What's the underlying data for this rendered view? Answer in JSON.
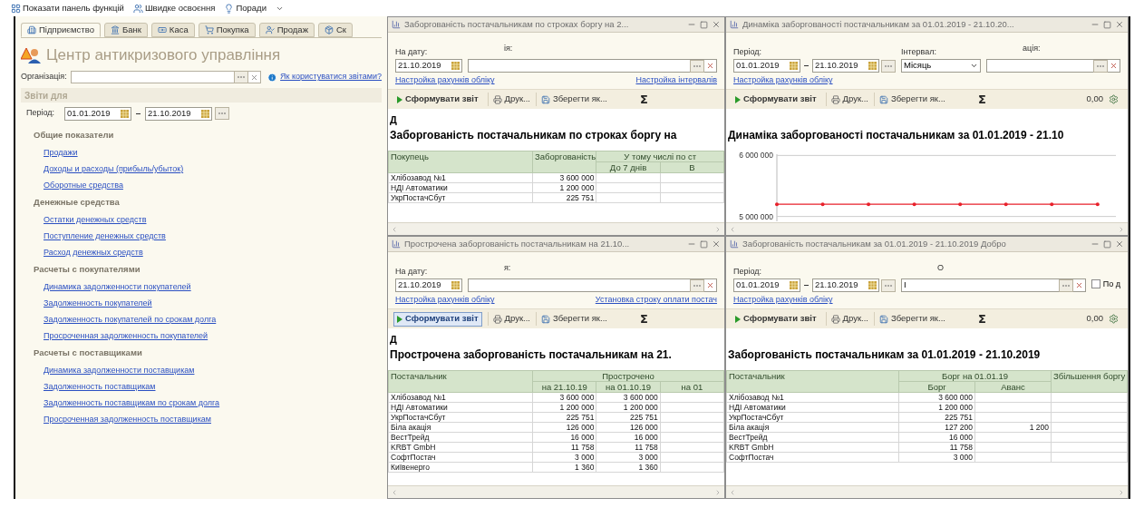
{
  "toolbar": [
    {
      "label": "Показати панель функцій"
    },
    {
      "label": "Швидке освоєння"
    },
    {
      "label": "Поради"
    }
  ],
  "main": {
    "tabs": [
      {
        "label": "Підприємство",
        "selected": true
      },
      {
        "label": "Банк",
        "selected": false
      },
      {
        "label": "Каса",
        "selected": false
      },
      {
        "label": "Покупка",
        "selected": false
      },
      {
        "label": "Продаж",
        "selected": false
      },
      {
        "label": "Ск",
        "selected": false
      }
    ],
    "title": "Центр антикризового управління",
    "organization": {
      "label": "Організація:"
    },
    "help_link": "Як користуватися звітами?",
    "section": "Звіти для",
    "period": {
      "label": "Період:",
      "from": "01.01.2019",
      "to": "21.10.2019"
    },
    "groups": [
      {
        "title": "Общие показатели",
        "links": [
          "Продажи",
          "Доходы и расходы (прибыль/убыток)",
          "Оборотные средства"
        ]
      },
      {
        "title": "Денежные средства",
        "links": [
          "Остатки денежных средств",
          "Поступление денежных средств",
          "Расход денежных средств"
        ]
      },
      {
        "title": "Расчеты с покупателями",
        "links": [
          "Динамика задолженности покупателей",
          "Задолженность покупателей",
          "Задолженность покупателей по срокам долга",
          "Просроченная задолженность покупателей"
        ]
      },
      {
        "title": "Расчеты с поставщиками",
        "links": [
          "Динамика задолженности поставщикам",
          "Задолженность поставщикам",
          "Задолженность поставщикам по срокам долга",
          "Просроченная задолженность поставщикам"
        ]
      }
    ]
  },
  "windows": [
    {
      "title": "Заборгованість постачальникам по строках боргу на 2...",
      "controls": [
        {
          "kind": "date",
          "label": "На дату:",
          "value": "21.10.2019"
        },
        {
          "kind": "org",
          "label": "ія:"
        }
      ],
      "links": [
        "Настройка рахунків обліку",
        "Настройка інтервалів"
      ],
      "toolbar": {
        "run": {
          "label": "Сформувати звіт",
          "selected": false
        },
        "print": "Друк...",
        "save": "Зберегти як...",
        "sigma": "Σ"
      },
      "report_prefix": "Д",
      "report_title": "Заборгованість постачальникам по строках боргу на",
      "table": {
        "header": [
          [
            {
              "text": "Покупець",
              "rowspan": 2
            },
            {
              "text": "Заборгованість",
              "rowspan": 2
            },
            {
              "text": "У тому числі по ст",
              "colspan": 2
            }
          ],
          [
            {
              "text": "До 7 днів"
            },
            {
              "text": "В"
            }
          ]
        ],
        "rows": [
          [
            "Хлібозавод №1",
            "3 600 000",
            null,
            null
          ],
          [
            "НДІ Автоматики",
            "1 200 000",
            null,
            null
          ],
          [
            "УкрПостачСбут",
            "225 751",
            null,
            null
          ]
        ]
      }
    },
    {
      "title": "Динаміка заборгованості постачальникам за 01.01.2019 - 21.10.20...",
      "controls": [
        {
          "kind": "period",
          "label": "Період:",
          "from": "01.01.2019",
          "to": "21.10.2019"
        },
        {
          "kind": "select",
          "label": "Інтервал:",
          "value": "Місяць"
        },
        {
          "kind": "org",
          "label": "ація:"
        }
      ],
      "links": [
        "Настройка рахунків обліку"
      ],
      "toolbar": {
        "run": {
          "label": "Сформувати звіт",
          "selected": false
        },
        "print": "Друк...",
        "save": "Зберегти як...",
        "sigma": "Σ",
        "sum": "0,00"
      },
      "report_title": "Динаміка заборгованості постачальникам за 01.01.2019 - 21.10",
      "chart_data": {
        "type": "line",
        "ylim": [
          4950000,
          6050000
        ],
        "yticks": [
          {
            "value": 5000000,
            "label": "5 000 000"
          },
          {
            "value": 6000000,
            "label": "6 000 000"
          }
        ],
        "series": [
          {
            "color": "#e8212b",
            "values": [
              5200000,
              5200000,
              5200000,
              5200000,
              5200000,
              5200000,
              5200000,
              5200000
            ]
          }
        ]
      }
    },
    {
      "title": "Прострочена заборгованість постачальникам на 21.10...",
      "controls": [
        {
          "kind": "date",
          "label": "На дату:",
          "value": "21.10.2019"
        },
        {
          "kind": "org",
          "label": "я:"
        }
      ],
      "links": [
        "Настройка рахунків обліку",
        "Установка строку оплати постач"
      ],
      "toolbar": {
        "run": {
          "label": "Сформувати звіт",
          "selected": true
        },
        "print": "Друк...",
        "save": "Зберегти як...",
        "sigma": "Σ"
      },
      "report_prefix": "Д",
      "report_title": "Прострочена заборгованість постачальникам на 21.",
      "table": {
        "header": [
          [
            {
              "text": "Постачальник",
              "rowspan": 2
            },
            {
              "text": "Прострочено",
              "colspan": 3
            }
          ],
          [
            {
              "text": "на 21.10.19"
            },
            {
              "text": "на 01.10.19"
            },
            {
              "text": "на 01"
            }
          ]
        ],
        "rows": [
          [
            "Хлібозавод №1",
            "3 600 000",
            "3 600 000",
            null
          ],
          [
            "НДІ Автоматики",
            "1 200 000",
            "1 200 000",
            null
          ],
          [
            "УкрПостачСбут",
            "225 751",
            "225 751",
            null
          ],
          [
            "Біла акація",
            "126 000",
            "126 000",
            null
          ],
          [
            "ВестТрейд",
            "16 000",
            "16 000",
            null
          ],
          [
            "KRBT GmbH",
            "11 758",
            "11 758",
            null
          ],
          [
            "СофтПостач",
            "3 000",
            "3 000",
            null
          ],
          [
            "Київенерго",
            "1 360",
            "1 360",
            null
          ]
        ]
      }
    },
    {
      "title": "Заборгованість постачальникам за 01.01.2019 - 21.10.2019 Добро",
      "controls": [
        {
          "kind": "period",
          "label": "Період:",
          "from": "01.01.2019",
          "to": "21.10.2019"
        },
        {
          "kind": "org",
          "label": "О",
          "value": "І"
        },
        {
          "kind": "checkbox",
          "label": "По д",
          "checked": false
        }
      ],
      "links": [
        "Настройка рахунків обліку"
      ],
      "toolbar": {
        "run": {
          "label": "Сформувати звіт",
          "selected": false
        },
        "print": "Друк...",
        "save": "Зберегти як...",
        "sigma": "Σ",
        "sum": "0,00"
      },
      "report_title": "Заборгованість постачальникам за 01.01.2019 - 21.10.2019",
      "table": {
        "header": [
          [
            {
              "text": "Постачальник",
              "rowspan": 2
            },
            {
              "text": "Борг на 01.01.19",
              "colspan": 2
            },
            {
              "text": "Збільшення боргу",
              "rowspan": 2
            }
          ],
          [
            {
              "text": "Борг"
            },
            {
              "text": "Аванс"
            }
          ]
        ],
        "rows": [
          [
            "Хлібозавод №1",
            "3 600 000",
            null,
            null
          ],
          [
            "НДІ Автоматики",
            "1 200 000",
            null,
            null
          ],
          [
            "УкрПостачСбут",
            "225 751",
            null,
            null
          ],
          [
            "Біла акація",
            "127 200",
            "1 200",
            null
          ],
          [
            "ВестТрейд",
            "16 000",
            null,
            null
          ],
          [
            "KRBT GmbH",
            "11 758",
            null,
            null
          ],
          [
            "СофтПостач",
            "3 000",
            null,
            null
          ]
        ]
      }
    }
  ]
}
